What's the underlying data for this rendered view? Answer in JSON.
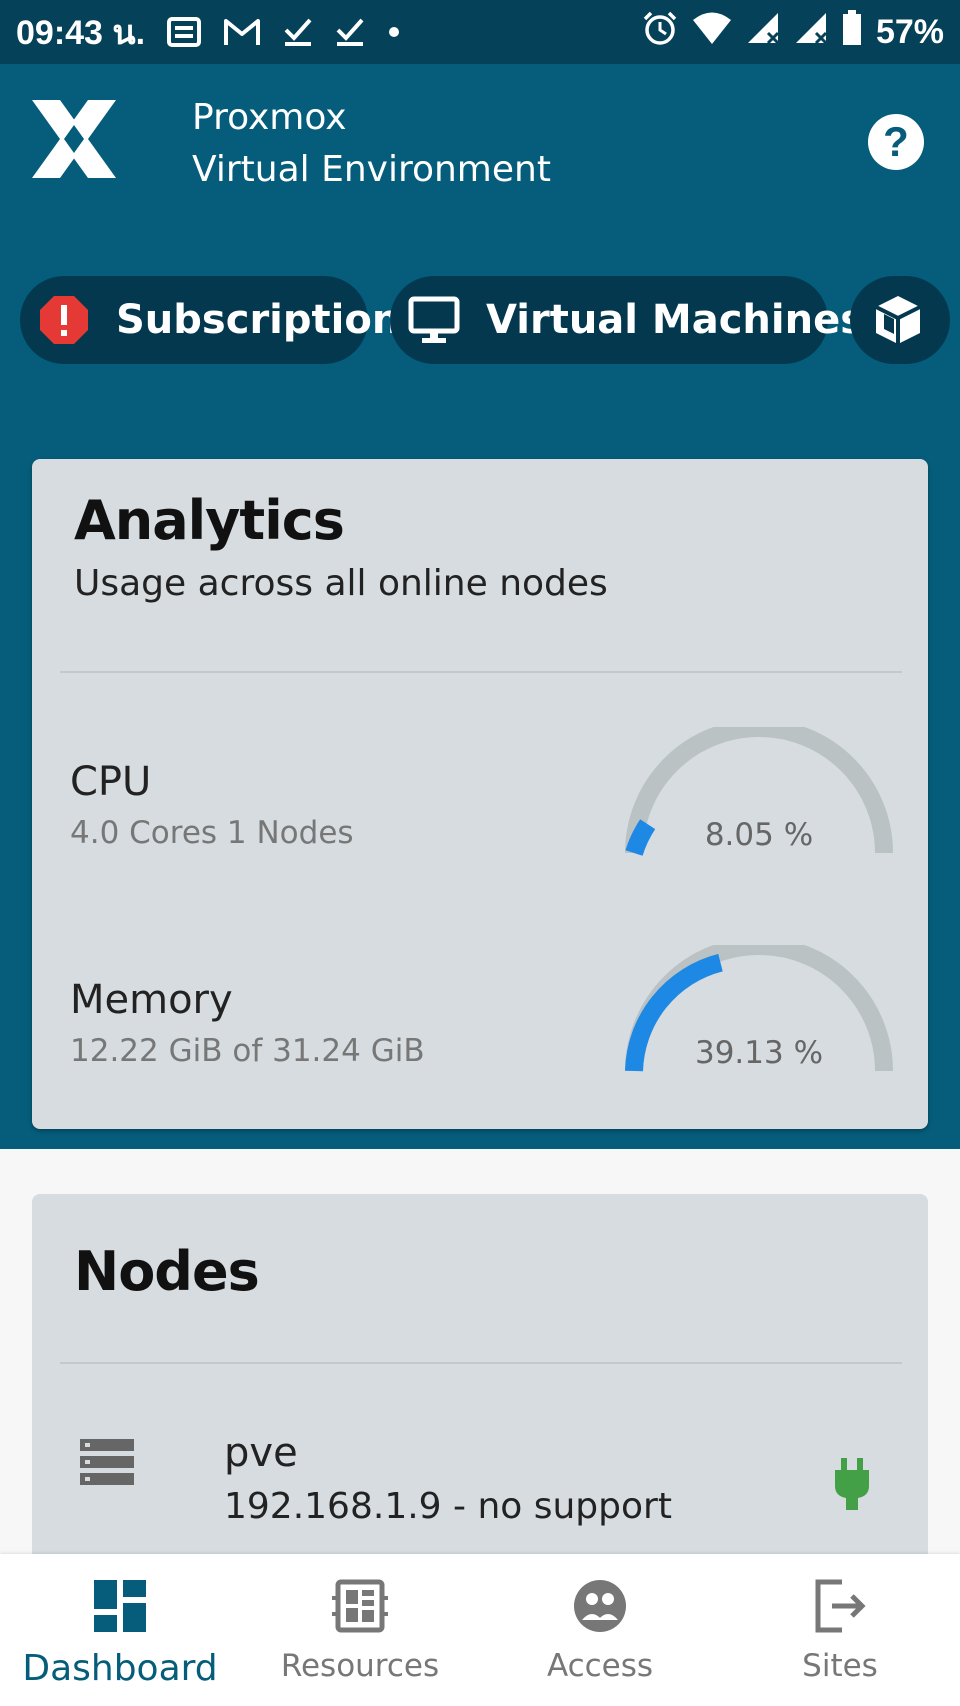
{
  "status_bar": {
    "time": "09:43 น.",
    "battery": "57%",
    "left_icons": [
      "news-icon",
      "gmail-icon",
      "check-icon",
      "check-icon",
      "dot-icon"
    ],
    "right_icons": [
      "alarm-icon",
      "wifi-icon",
      "signal-icon",
      "signal-icon",
      "battery-icon"
    ]
  },
  "header": {
    "title_line1": "Proxmox",
    "title_line2": "Virtual Environment",
    "help_label": "?"
  },
  "chips": [
    {
      "label": "Subscription",
      "icon": "alert-icon"
    },
    {
      "label": "Virtual Machines",
      "icon": "monitor-icon"
    },
    {
      "label": "",
      "icon": "container-icon"
    }
  ],
  "analytics": {
    "title": "Analytics",
    "subtitle": "Usage across all online nodes",
    "cpu": {
      "name": "CPU",
      "detail": "4.0 Cores 1 Nodes",
      "value_label": "8.05 %",
      "percent": 8.05
    },
    "memory": {
      "name": "Memory",
      "detail": "12.22 GiB of 31.24 GiB",
      "value_label": "39.13 %",
      "percent": 39.13
    }
  },
  "nodes": {
    "title": "Nodes",
    "items": [
      {
        "name": "pve",
        "detail": "192.168.1.9 - no support",
        "status": "online"
      }
    ]
  },
  "bottom_nav": [
    {
      "label": "Dashboard",
      "icon": "dashboard-icon",
      "active": true
    },
    {
      "label": "Resources",
      "icon": "resources-icon",
      "active": false
    },
    {
      "label": "Access",
      "icon": "access-icon",
      "active": false
    },
    {
      "label": "Sites",
      "icon": "sites-icon",
      "active": false
    }
  ],
  "colors": {
    "header_bg": "#055d7b",
    "status_bg": "#054158",
    "chip_bg": "#03384e",
    "card_bg": "#d6dcdf",
    "gauge_fill": "#1e88e5",
    "gauge_track": "#bbc2c4",
    "online": "#43a047",
    "alert": "#e53935"
  }
}
